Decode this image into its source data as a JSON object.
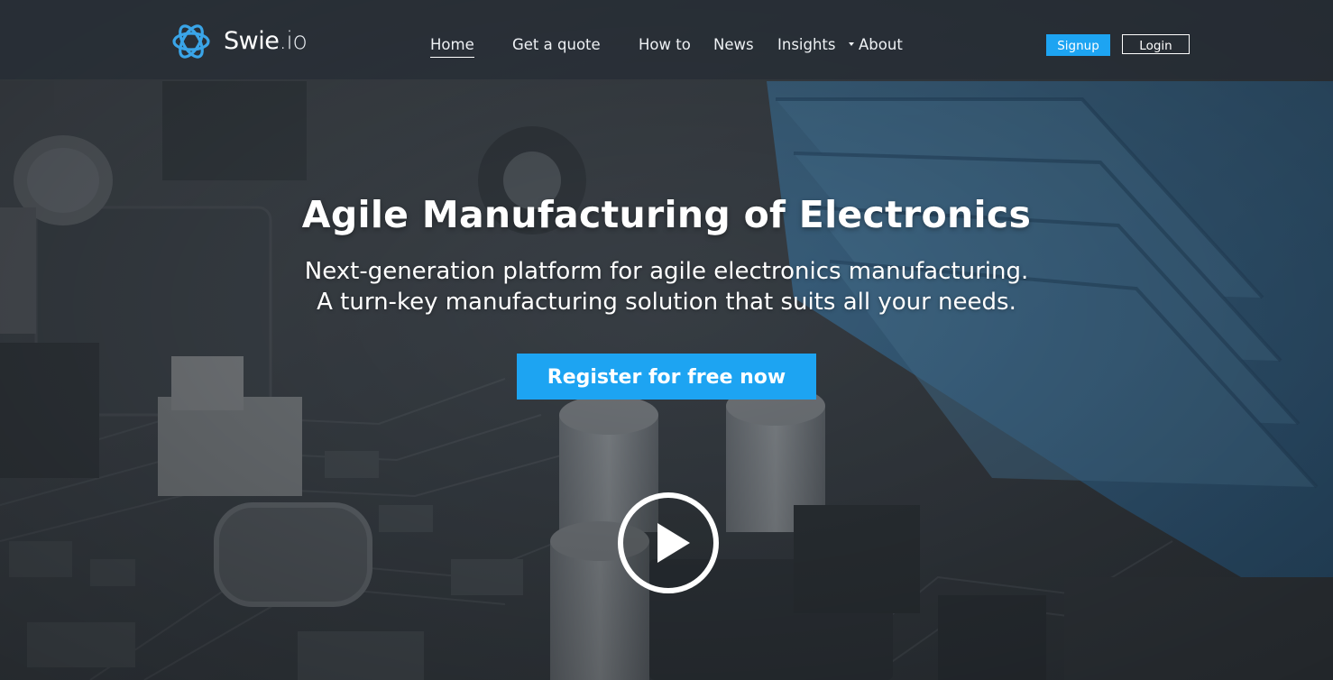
{
  "brand": {
    "name_main": "Swie",
    "name_suffix": ".io",
    "accent_color": "#1da4f2"
  },
  "nav": {
    "items": [
      {
        "label": "Home",
        "active": true
      },
      {
        "label": "Get a quote"
      },
      {
        "label": "How to"
      },
      {
        "label": "News"
      },
      {
        "label": "Insights"
      },
      {
        "label": "About",
        "has_dropdown": true
      }
    ],
    "signup_label": "Signup",
    "login_label": "Login"
  },
  "hero": {
    "title": "Agile Manufacturing of Electronics",
    "subtitle_line1": "Next-generation platform for agile electronics manufacturing.",
    "subtitle_line2": "A turn-key manufacturing solution that suits all your needs.",
    "cta_label": "Register for free now",
    "video_icon": "play-icon"
  },
  "background": {
    "description_icon": "circuit-board-photo",
    "overlay_color": "#2b3138",
    "heatsink_color": "#3a86c2"
  }
}
